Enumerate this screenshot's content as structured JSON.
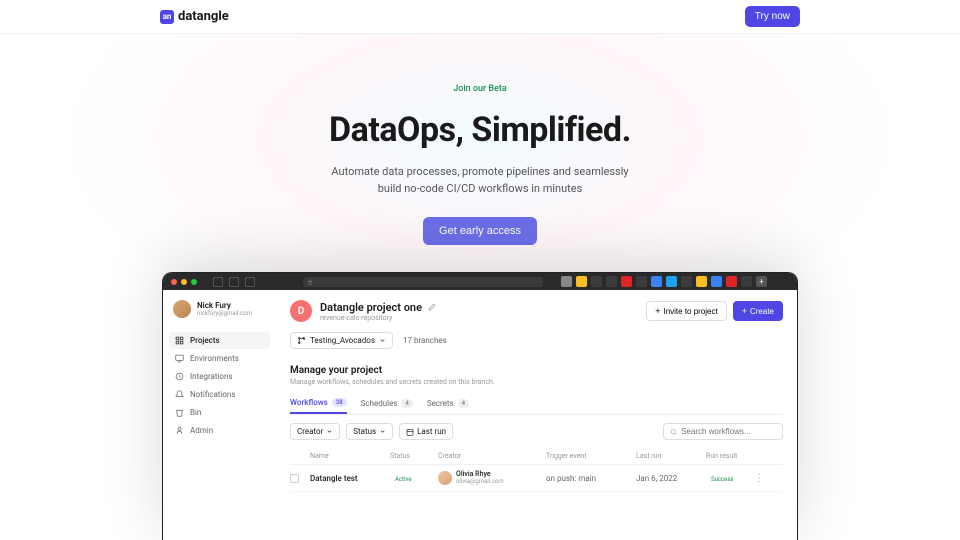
{
  "nav": {
    "brand": "datangle",
    "cta": "Try now"
  },
  "hero": {
    "badge": "Join our Beta",
    "title": "DataOps, Simplified.",
    "subtitle_l1": "Automate data processes, promote pipelines and seamlessly",
    "subtitle_l2": "build no-code CI/CD workflows in minutes",
    "cta": "Get early access"
  },
  "app": {
    "user": {
      "name": "Nick Fury",
      "email": "nickfury@gmail.com"
    },
    "sidebar": {
      "items": [
        {
          "label": "Projects"
        },
        {
          "label": "Environments"
        },
        {
          "label": "Integrations"
        },
        {
          "label": "Notifications"
        },
        {
          "label": "Bin"
        },
        {
          "label": "Admin"
        }
      ]
    },
    "project": {
      "initial": "D",
      "title": "Datangle project one",
      "repo": "revenue-calc-repository",
      "invite": "Invite to project",
      "create": "Create",
      "branch": "Testing_Avocados",
      "branch_count": "17 branches"
    },
    "section": {
      "title": "Manage your project",
      "sub": "Manage workflows, schedules and secrets created on this branch."
    },
    "tabs": [
      {
        "label": "Workflows",
        "count": "38"
      },
      {
        "label": "Schedules",
        "count": "4"
      },
      {
        "label": "Secrets",
        "count": "4"
      }
    ],
    "filters": {
      "creator": "Creator",
      "status": "Status",
      "lastrun": "Last run",
      "search_placeholder": "Search workflows..."
    },
    "table": {
      "headers": {
        "name": "Name",
        "status": "Status",
        "creator": "Creator",
        "trigger": "Trigger event",
        "lastrun": "Last run",
        "result": "Run result"
      },
      "rows": [
        {
          "name": "Datangle test",
          "status": "Active",
          "creator_name": "Olivia Rhye",
          "creator_email": "olivia@gmail.com",
          "trigger": "on push: main",
          "lastrun": "Jan 6, 2022",
          "result": "Success"
        }
      ]
    }
  }
}
